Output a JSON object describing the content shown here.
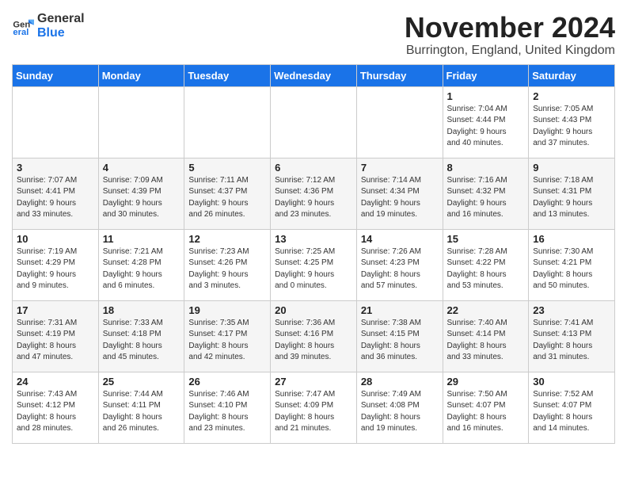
{
  "header": {
    "logo_general": "General",
    "logo_blue": "Blue",
    "month_title": "November 2024",
    "location": "Burrington, England, United Kingdom"
  },
  "weekdays": [
    "Sunday",
    "Monday",
    "Tuesday",
    "Wednesday",
    "Thursday",
    "Friday",
    "Saturday"
  ],
  "weeks": [
    [
      {
        "day": "",
        "info": ""
      },
      {
        "day": "",
        "info": ""
      },
      {
        "day": "",
        "info": ""
      },
      {
        "day": "",
        "info": ""
      },
      {
        "day": "",
        "info": ""
      },
      {
        "day": "1",
        "info": "Sunrise: 7:04 AM\nSunset: 4:44 PM\nDaylight: 9 hours\nand 40 minutes."
      },
      {
        "day": "2",
        "info": "Sunrise: 7:05 AM\nSunset: 4:43 PM\nDaylight: 9 hours\nand 37 minutes."
      }
    ],
    [
      {
        "day": "3",
        "info": "Sunrise: 7:07 AM\nSunset: 4:41 PM\nDaylight: 9 hours\nand 33 minutes."
      },
      {
        "day": "4",
        "info": "Sunrise: 7:09 AM\nSunset: 4:39 PM\nDaylight: 9 hours\nand 30 minutes."
      },
      {
        "day": "5",
        "info": "Sunrise: 7:11 AM\nSunset: 4:37 PM\nDaylight: 9 hours\nand 26 minutes."
      },
      {
        "day": "6",
        "info": "Sunrise: 7:12 AM\nSunset: 4:36 PM\nDaylight: 9 hours\nand 23 minutes."
      },
      {
        "day": "7",
        "info": "Sunrise: 7:14 AM\nSunset: 4:34 PM\nDaylight: 9 hours\nand 19 minutes."
      },
      {
        "day": "8",
        "info": "Sunrise: 7:16 AM\nSunset: 4:32 PM\nDaylight: 9 hours\nand 16 minutes."
      },
      {
        "day": "9",
        "info": "Sunrise: 7:18 AM\nSunset: 4:31 PM\nDaylight: 9 hours\nand 13 minutes."
      }
    ],
    [
      {
        "day": "10",
        "info": "Sunrise: 7:19 AM\nSunset: 4:29 PM\nDaylight: 9 hours\nand 9 minutes."
      },
      {
        "day": "11",
        "info": "Sunrise: 7:21 AM\nSunset: 4:28 PM\nDaylight: 9 hours\nand 6 minutes."
      },
      {
        "day": "12",
        "info": "Sunrise: 7:23 AM\nSunset: 4:26 PM\nDaylight: 9 hours\nand 3 minutes."
      },
      {
        "day": "13",
        "info": "Sunrise: 7:25 AM\nSunset: 4:25 PM\nDaylight: 9 hours\nand 0 minutes."
      },
      {
        "day": "14",
        "info": "Sunrise: 7:26 AM\nSunset: 4:23 PM\nDaylight: 8 hours\nand 57 minutes."
      },
      {
        "day": "15",
        "info": "Sunrise: 7:28 AM\nSunset: 4:22 PM\nDaylight: 8 hours\nand 53 minutes."
      },
      {
        "day": "16",
        "info": "Sunrise: 7:30 AM\nSunset: 4:21 PM\nDaylight: 8 hours\nand 50 minutes."
      }
    ],
    [
      {
        "day": "17",
        "info": "Sunrise: 7:31 AM\nSunset: 4:19 PM\nDaylight: 8 hours\nand 47 minutes."
      },
      {
        "day": "18",
        "info": "Sunrise: 7:33 AM\nSunset: 4:18 PM\nDaylight: 8 hours\nand 45 minutes."
      },
      {
        "day": "19",
        "info": "Sunrise: 7:35 AM\nSunset: 4:17 PM\nDaylight: 8 hours\nand 42 minutes."
      },
      {
        "day": "20",
        "info": "Sunrise: 7:36 AM\nSunset: 4:16 PM\nDaylight: 8 hours\nand 39 minutes."
      },
      {
        "day": "21",
        "info": "Sunrise: 7:38 AM\nSunset: 4:15 PM\nDaylight: 8 hours\nand 36 minutes."
      },
      {
        "day": "22",
        "info": "Sunrise: 7:40 AM\nSunset: 4:14 PM\nDaylight: 8 hours\nand 33 minutes."
      },
      {
        "day": "23",
        "info": "Sunrise: 7:41 AM\nSunset: 4:13 PM\nDaylight: 8 hours\nand 31 minutes."
      }
    ],
    [
      {
        "day": "24",
        "info": "Sunrise: 7:43 AM\nSunset: 4:12 PM\nDaylight: 8 hours\nand 28 minutes."
      },
      {
        "day": "25",
        "info": "Sunrise: 7:44 AM\nSunset: 4:11 PM\nDaylight: 8 hours\nand 26 minutes."
      },
      {
        "day": "26",
        "info": "Sunrise: 7:46 AM\nSunset: 4:10 PM\nDaylight: 8 hours\nand 23 minutes."
      },
      {
        "day": "27",
        "info": "Sunrise: 7:47 AM\nSunset: 4:09 PM\nDaylight: 8 hours\nand 21 minutes."
      },
      {
        "day": "28",
        "info": "Sunrise: 7:49 AM\nSunset: 4:08 PM\nDaylight: 8 hours\nand 19 minutes."
      },
      {
        "day": "29",
        "info": "Sunrise: 7:50 AM\nSunset: 4:07 PM\nDaylight: 8 hours\nand 16 minutes."
      },
      {
        "day": "30",
        "info": "Sunrise: 7:52 AM\nSunset: 4:07 PM\nDaylight: 8 hours\nand 14 minutes."
      }
    ]
  ]
}
